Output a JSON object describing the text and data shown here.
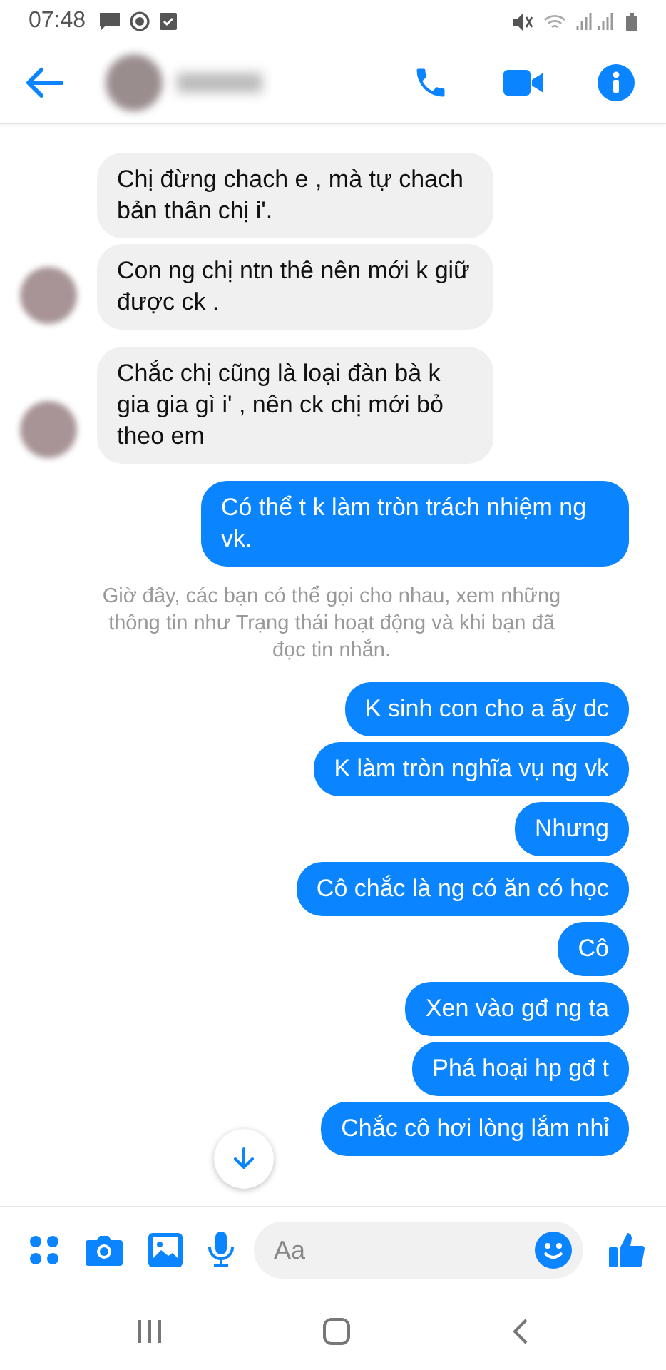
{
  "status_bar": {
    "time": "07:48"
  },
  "composer": {
    "placeholder": "Aa"
  },
  "messages": [
    {
      "kind": "incoming",
      "bubbles": [
        "Chị đừng chach e , mà tự chach bản thân chị i'.",
        "Con ng chị ntn thê nên mới k giữ được ck ."
      ]
    },
    {
      "kind": "incoming",
      "bubbles": [
        "Chắc chị cũng là loại đàn bà k gia gia gì i' , nên ck chị mới bỏ theo em"
      ]
    },
    {
      "kind": "outgoing",
      "bubbles": [
        "Có thể t k làm tròn trách nhiệm ng vk."
      ]
    },
    {
      "kind": "notice",
      "text": "Giờ đây, các bạn có thể gọi cho nhau, xem những thông tin như Trạng thái hoạt động và khi bạn đã đọc tin nhắn."
    },
    {
      "kind": "outgoing",
      "bubbles": [
        "K sinh con cho a ấy dc",
        "K làm tròn nghĩa vụ ng vk",
        "Nhưng",
        "Cô chắc là ng có ăn có học",
        "Cô",
        "Xen vào gđ ng ta",
        "Phá hoại hp gđ t",
        "Chắc cô hơi lòng lắm nhỉ"
      ]
    }
  ]
}
